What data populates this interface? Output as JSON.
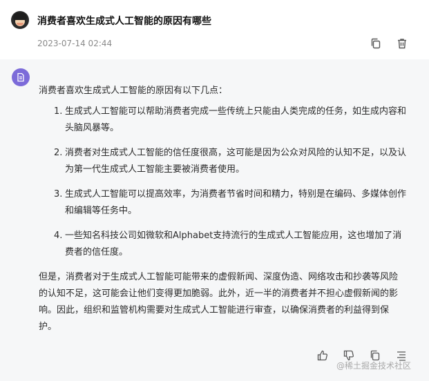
{
  "question": {
    "title": "消费者喜欢生成式人工智能的原因有哪些",
    "timestamp": "2023-07-14 02:44",
    "icons": [
      "copy-icon",
      "trash-icon"
    ]
  },
  "answer": {
    "intro": "消费者喜欢生成式人工智能的原因有以下几点：",
    "points": [
      {
        "num": "1.",
        "text": "生成式人工智能可以帮助消费者完成一些传统上只能由人类完成的任务，如生成内容和头脑风暴等。"
      },
      {
        "num": "2.",
        "text": "消费者对生成式人工智能的信任度很高，这可能是因为公众对风险的认知不足，以及认为第一代生成式人工智能主要被消费者使用。"
      },
      {
        "num": "3.",
        "text": "生成式人工智能可以提高效率，为消费者节省时间和精力，特别是在编码、多媒体创作和编辑等任务中。"
      },
      {
        "num": "4.",
        "text": "一些知名科技公司如微软和Alphabet支持流行的生成式人工智能应用，这也增加了消费者的信任度。"
      }
    ],
    "outro": "但是，消费者对于生成式人工智能可能带来的虚假新闻、深度伪造、网络攻击和抄袭等风险的认知不足，这可能会让他们变得更加脆弱。此外，近一半的消费者并不担心虚假新闻的影响。因此，组织和监管机构需要对生成式人工智能进行审查，以确保消费者的利益得到保护。",
    "actions": [
      "thumbs-up-icon",
      "thumbs-down-icon",
      "copy-icon",
      "list-icon"
    ]
  },
  "watermark": "@稀土掘金技术社区",
  "colors": {
    "accent": "#7c6bd9",
    "answer_bg": "#f6f7f8",
    "muted": "#8a8a8a"
  }
}
